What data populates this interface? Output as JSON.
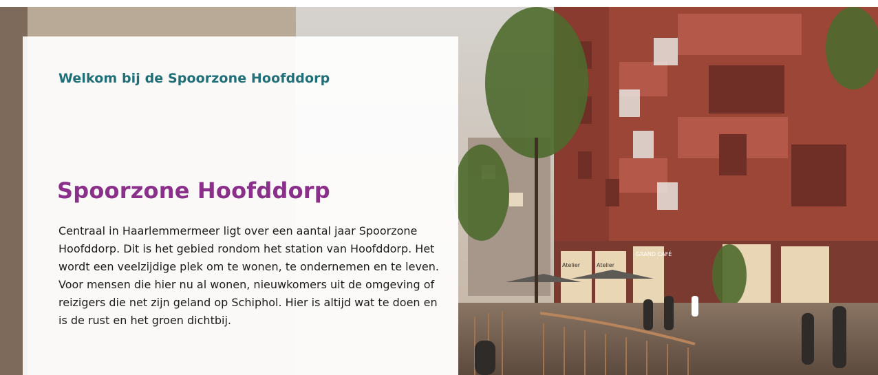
{
  "intro": {
    "eyebrow": "Welkom bij de Spoorzone Hoofddorp",
    "title": "Spoorzone Hoofddorp",
    "body": "Centraal in Haarlemmermeer ligt over een aantal jaar Spoorzone Hoofddorp. Dit is het gebied rondom het station van Hoofddorp. Het wordt een veelzijdige plek om te wonen, te ondernemen en te leven. Voor mensen die hier nu al wonen, nieuwkomers uit de omgeving of reizigers die net zijn geland op Schiphol. Hier is altijd wat te doen en is de rust en het groen dichtbij."
  },
  "hero": {
    "storefront_signs": [
      "Atelier",
      "Atelier",
      "GRAND CAFÉ"
    ]
  },
  "colors": {
    "eyebrow": "#1f6f78",
    "title": "#8a2f8a",
    "body": "#1b1b1b",
    "building": "#9c4638"
  }
}
